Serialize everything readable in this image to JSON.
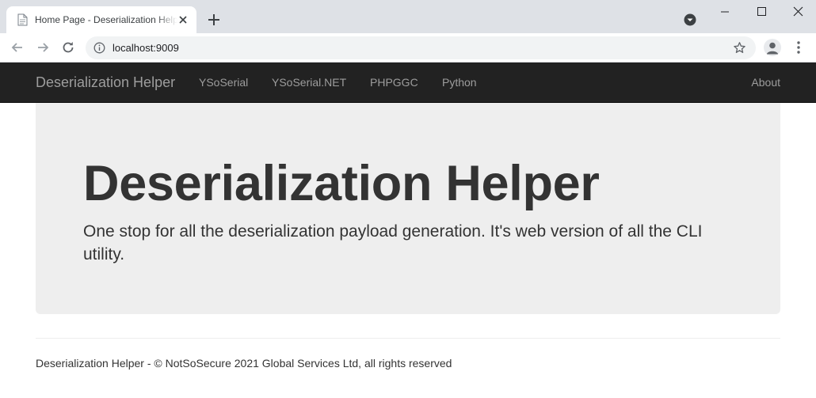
{
  "browser": {
    "tab": {
      "title": "Home Page - Deserialization Helper"
    },
    "address_bar": {
      "url": "localhost:9009"
    }
  },
  "navbar": {
    "brand": "Deserialization Helper",
    "links": [
      {
        "label": "YSoSerial"
      },
      {
        "label": "YSoSerial.NET"
      },
      {
        "label": "PHPGGC"
      },
      {
        "label": "Python"
      }
    ],
    "right_link": {
      "label": "About"
    }
  },
  "jumbotron": {
    "title": "Deserialization Helper",
    "lead": "One stop for all the deserialization payload generation. It's web version of all the CLI utility."
  },
  "footer": {
    "text": "Deserialization Helper - © NotSoSecure 2021 Global Services Ltd, all rights reserved"
  },
  "colors": {
    "navbar_bg": "#222222",
    "navbar_text": "#9d9d9d",
    "jumbotron_bg": "#eeeeee",
    "body_text": "#333333",
    "tabstrip_bg": "#dee1e6"
  }
}
